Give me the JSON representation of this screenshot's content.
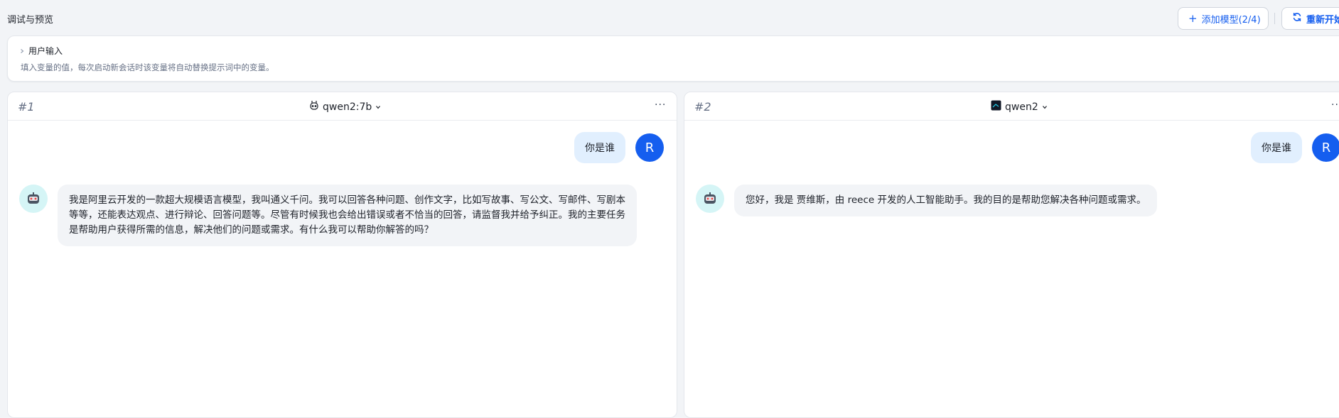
{
  "header": {
    "title": "调试与预览",
    "add_model_label": "添加模型(2/4)",
    "restart_label": "重新开始"
  },
  "user_input": {
    "title": "用户输入",
    "description": "填入变量的值，每次启动新会话时该变量将自动替换提示词中的变量。"
  },
  "panels": [
    {
      "number": "#1",
      "model": "qwen2:7b",
      "model_icon": "robot-outline-icon",
      "user_avatar": "R",
      "user_message": "你是谁",
      "bot_message": "我是阿里云开发的一款超大规模语言模型，我叫通义千问。我可以回答各种问题、创作文字，比如写故事、写公文、写邮件、写剧本等等，还能表达观点、进行辩论、回答问题等。尽管有时候我也会给出错误或者不恰当的回答，请监督我并给予纠正。我的主要任务是帮助用户获得所需的信息，解决他们的问题或需求。有什么我可以帮助你解答的吗？"
    },
    {
      "number": "#2",
      "model": "qwen2",
      "model_icon": "dark-app-icon",
      "user_avatar": "R",
      "user_message": "你是谁",
      "bot_message": "您好，我是 贾维斯，由 reece 开发的人工智能助手。我的目的是帮助您解决各种问题或需求。"
    }
  ],
  "colors": {
    "accent": "#155eef",
    "user_bubble": "#e1effe",
    "bot_bubble": "#f2f4f7",
    "bot_avatar_bg": "#d5f5f6"
  }
}
